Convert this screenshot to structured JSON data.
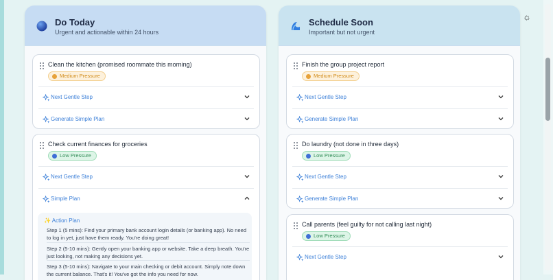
{
  "theme_toggle": {
    "icon": "sun-icon",
    "glyph": "☼"
  },
  "columns": [
    {
      "title": "Do Today",
      "subtitle": "Urgent and actionable within 24 hours",
      "icon": "moon-sphere-icon",
      "tasks": [
        {
          "title": "Clean the kitchen (promised roommate this morning)",
          "pressure": "Medium Pressure",
          "rows": [
            {
              "label": "Next Gentle Step",
              "expanded": false
            },
            {
              "label": "Generate Simple Plan",
              "expanded": false
            }
          ]
        },
        {
          "title": "Check current finances for groceries",
          "pressure": "Low Pressure",
          "rows": [
            {
              "label": "Next Gentle Step",
              "expanded": false
            },
            {
              "label": "Simple Plan",
              "expanded": true
            }
          ],
          "plan": {
            "title": "✨ Action Plan",
            "steps": [
              "Step 1 (5 mins): Find your primary bank account login details (or banking app). No need to log in yet, just have them ready. You're doing great!",
              "Step 2 (5-10 mins): Gently open your banking app or website. Take a deep breath. You're just looking, not making any decisions yet.",
              "Step 3 (5-10 mins): Navigate to your main checking or debit account. Simply note down the current balance. That's it! You've got the info you need for now."
            ]
          }
        }
      ]
    },
    {
      "title": "Schedule Soon",
      "subtitle": "Important but not urgent",
      "icon": "wave-icon",
      "tasks": [
        {
          "title": "Finish the group project report",
          "pressure": "Medium Pressure",
          "rows": [
            {
              "label": "Next Gentle Step",
              "expanded": false
            },
            {
              "label": "Generate Simple Plan",
              "expanded": false
            }
          ]
        },
        {
          "title": "Do laundry (not done in three days)",
          "pressure": "Low Pressure",
          "rows": [
            {
              "label": "Next Gentle Step",
              "expanded": false
            },
            {
              "label": "Generate Simple Plan",
              "expanded": false
            }
          ]
        },
        {
          "title": "Call parents (feel guilty for not calling last night)",
          "pressure": "Low Pressure",
          "rows": [
            {
              "label": "Next Gentle Step",
              "expanded": false
            }
          ]
        }
      ]
    }
  ]
}
